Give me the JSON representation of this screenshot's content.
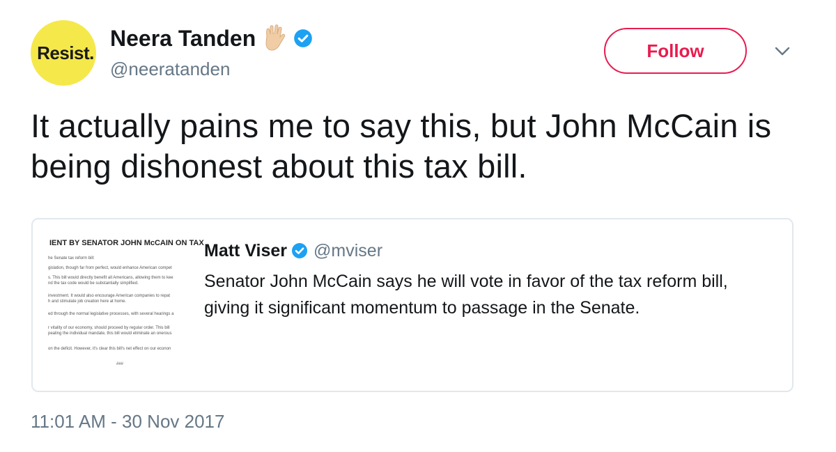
{
  "author": {
    "avatar_text": "Resist.",
    "display_name": "Neera Tanden",
    "emoji_icon": "vulcan-salute-icon",
    "verified_icon": "verified-badge-icon",
    "handle": "@neeratanden"
  },
  "actions": {
    "follow_label": "Follow",
    "menu_icon": "chevron-down-icon"
  },
  "tweet": {
    "text": "It actually pains me to say this, but John McCain is being dishonest about this tax bill.",
    "timestamp": "11:01 AM - 30 Nov 2017"
  },
  "quoted": {
    "name": "Matt Viser",
    "handle": "@mviser",
    "text": "Senator John McCain says he will vote in favor of the tax reform bill, giving it significant momentum to passage in the Senate.",
    "image": {
      "title": "IENT BY SENATOR JOHN McCAIN ON TAX",
      "lines": [
        "he Senate tax reform bill:",
        "gislation, though far from perfect, would enhance American compet",
        "s. This bill would directly benefit all Americans, allowing them to kee",
        "nd the tax code would be substantially simplified.",
        "investment. It would also encourage American companies to repat",
        "h and stimulate job creation here at home.",
        "ed through the normal legislative processes, with several hearings a",
        "r vitality of our economy, should proceed by regular order. This bill",
        "pealing the individual mandate, this bill would eliminate an onerous",
        "on the deficit. However, it's clear this bill's net effect on our econon",
        "###"
      ]
    }
  },
  "colors": {
    "follow_accent": "#e81c4f",
    "verified_blue": "#1da1f2",
    "avatar_yellow": "#f5e84a",
    "muted_text": "#657786"
  }
}
